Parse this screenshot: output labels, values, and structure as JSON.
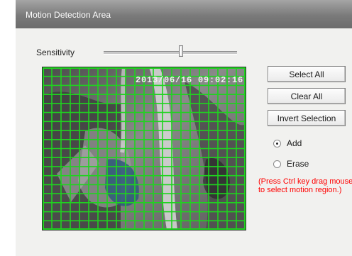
{
  "window": {
    "title": "Motion Detection Area"
  },
  "sensitivity": {
    "label": "Sensitivity",
    "level": 0.58
  },
  "video": {
    "timestamp": "2013/06/16 09:02:16",
    "grid": {
      "columns": 22,
      "rows": 18,
      "selected_all": true,
      "color": "#1fd31f"
    }
  },
  "buttons": {
    "select_all": "Select All",
    "clear_all": "Clear All",
    "invert_selection": "Invert Selection"
  },
  "mode": {
    "add": "Add",
    "erase": "Erase",
    "selected": "add"
  },
  "hint": "(Press Ctrl key drag mouse to select motion region.)",
  "colors": {
    "hint": "#ff0000",
    "grid": "#1fd31f",
    "title_bar": "#7a7a7a"
  }
}
